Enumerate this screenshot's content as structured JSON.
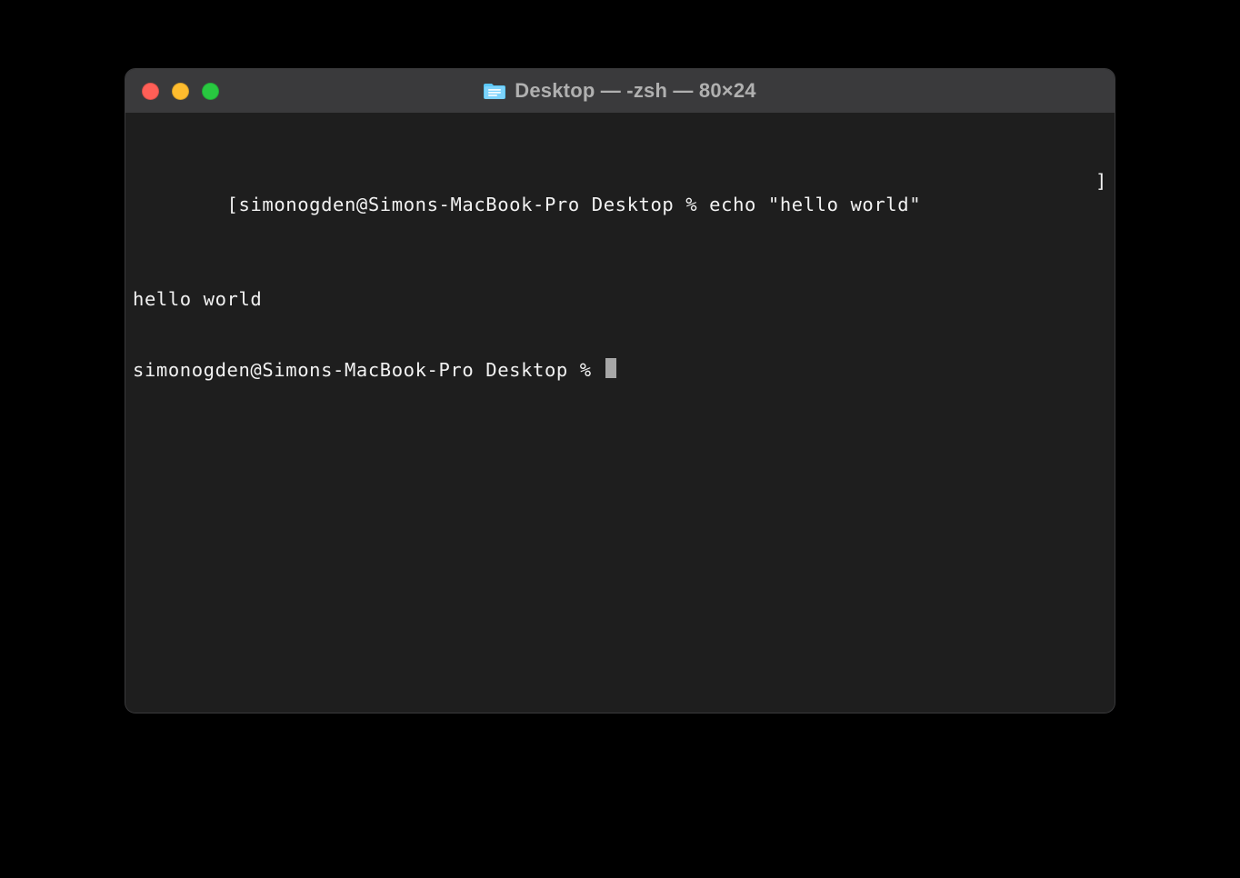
{
  "window": {
    "title": "Desktop — -zsh — 80×24"
  },
  "traffic_lights": {
    "close": "close",
    "minimize": "minimize",
    "zoom": "zoom"
  },
  "terminal": {
    "line1_open_bracket": "[",
    "line1_text": "simonogden@Simons-MacBook-Pro Desktop % echo \"hello world\"",
    "line1_close_bracket": "]",
    "line2_text": "hello world",
    "line3_text": "simonogden@Simons-MacBook-Pro Desktop % "
  }
}
